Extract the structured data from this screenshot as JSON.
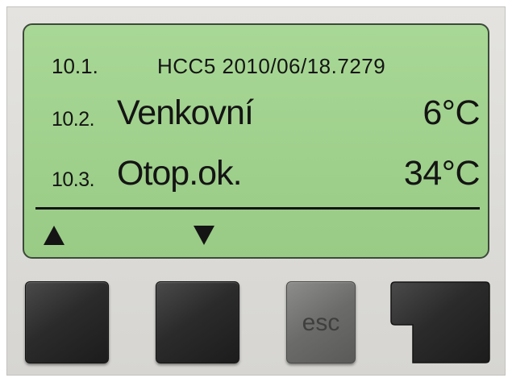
{
  "display": {
    "row1": {
      "number": "10.1.",
      "info": "HCC5 2010/06/18.7279"
    },
    "row2": {
      "number": "10.2.",
      "label": "Venkovní",
      "value": "6°C"
    },
    "row3": {
      "number": "10.3.",
      "label": "Otop.ok.",
      "value": "34°C"
    },
    "nav": {
      "up_icon": "triangle-up-icon",
      "down_icon": "triangle-down-icon"
    }
  },
  "buttons": {
    "esc_label": "esc"
  },
  "colors": {
    "lcd_background": "#a9d896",
    "lcd_text": "#141414",
    "button_dark": "#2b2b2b",
    "button_esc": "#6b6b69"
  }
}
